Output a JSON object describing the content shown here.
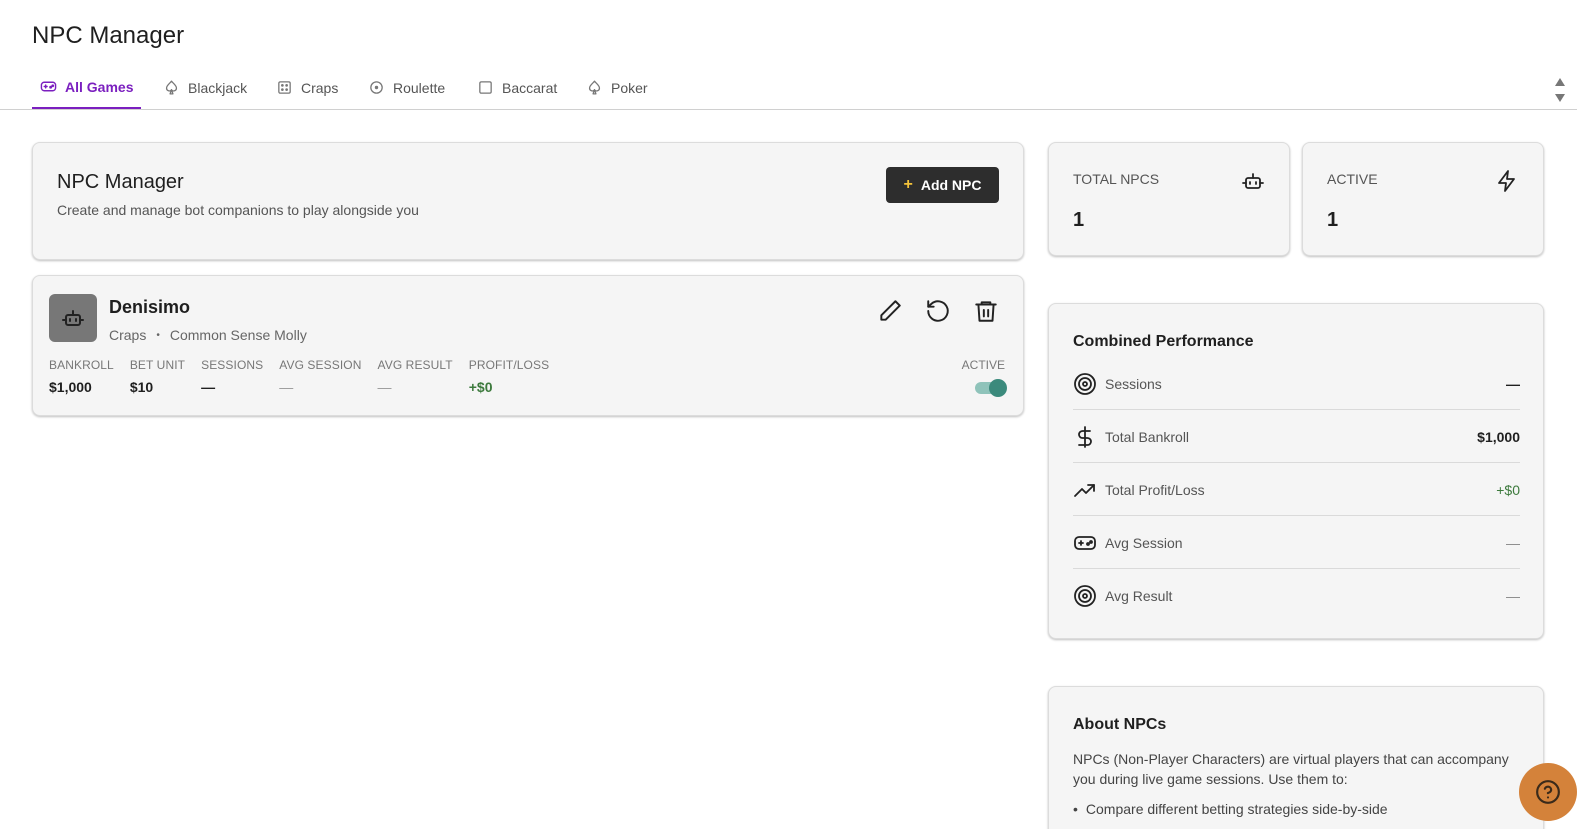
{
  "page": {
    "title": "NPC Manager"
  },
  "tabs": [
    {
      "label": "All Games",
      "icon": "gamepad-icon",
      "active": true
    },
    {
      "label": "Blackjack",
      "icon": "spade-icon"
    },
    {
      "label": "Craps",
      "icon": "dice-icon"
    },
    {
      "label": "Roulette",
      "icon": "roulette-icon"
    },
    {
      "label": "Baccarat",
      "icon": "square-icon"
    },
    {
      "label": "Poker",
      "icon": "spade-icon"
    }
  ],
  "header": {
    "title": "NPC Manager",
    "subtitle": "Create and manage bot companions to play alongside you",
    "add_label": "Add NPC"
  },
  "npc": {
    "name": "Denisimo",
    "game": "Craps",
    "separator": "•",
    "strategy": "Common Sense Molly",
    "stats": [
      {
        "label": "BANKROLL",
        "value": "$1,000"
      },
      {
        "label": "BET UNIT",
        "value": "$10"
      },
      {
        "label": "SESSIONS",
        "value": "—"
      },
      {
        "label": "AVG SESSION",
        "value": "—"
      },
      {
        "label": "AVG RESULT",
        "value": "—"
      },
      {
        "label": "PROFIT/LOSS",
        "value": "+$0"
      }
    ],
    "active_label": "ACTIVE",
    "active": true
  },
  "kpis": {
    "total": {
      "label": "TOTAL NPCS",
      "value": "1",
      "icon": "robot-icon"
    },
    "active": {
      "label": "ACTIVE",
      "value": "1",
      "icon": "lightning-icon"
    }
  },
  "performance": {
    "title": "Combined Performance",
    "rows": [
      {
        "label": "Sessions",
        "value": "—",
        "icon": "target-icon"
      },
      {
        "label": "Total Bankroll",
        "value": "$1,000",
        "icon": "dollar-icon"
      },
      {
        "label": "Total Profit/Loss",
        "value": "+$0",
        "icon": "trending-up-icon"
      },
      {
        "label": "Avg Session",
        "value": "—",
        "icon": "gamepad-icon"
      },
      {
        "label": "Avg Result",
        "value": "—",
        "icon": "target-icon"
      }
    ]
  },
  "about": {
    "title": "About NPCs",
    "text": "NPCs (Non-Player Characters) are virtual players that can accompany you during live game sessions. Use them to:",
    "items": [
      "Compare different betting strategies side-by-side"
    ]
  },
  "colors": {
    "accent": "#7b1fbf",
    "positive": "#3d7a3d",
    "toggle": "#3b8a7c",
    "help": "#d4823a"
  }
}
